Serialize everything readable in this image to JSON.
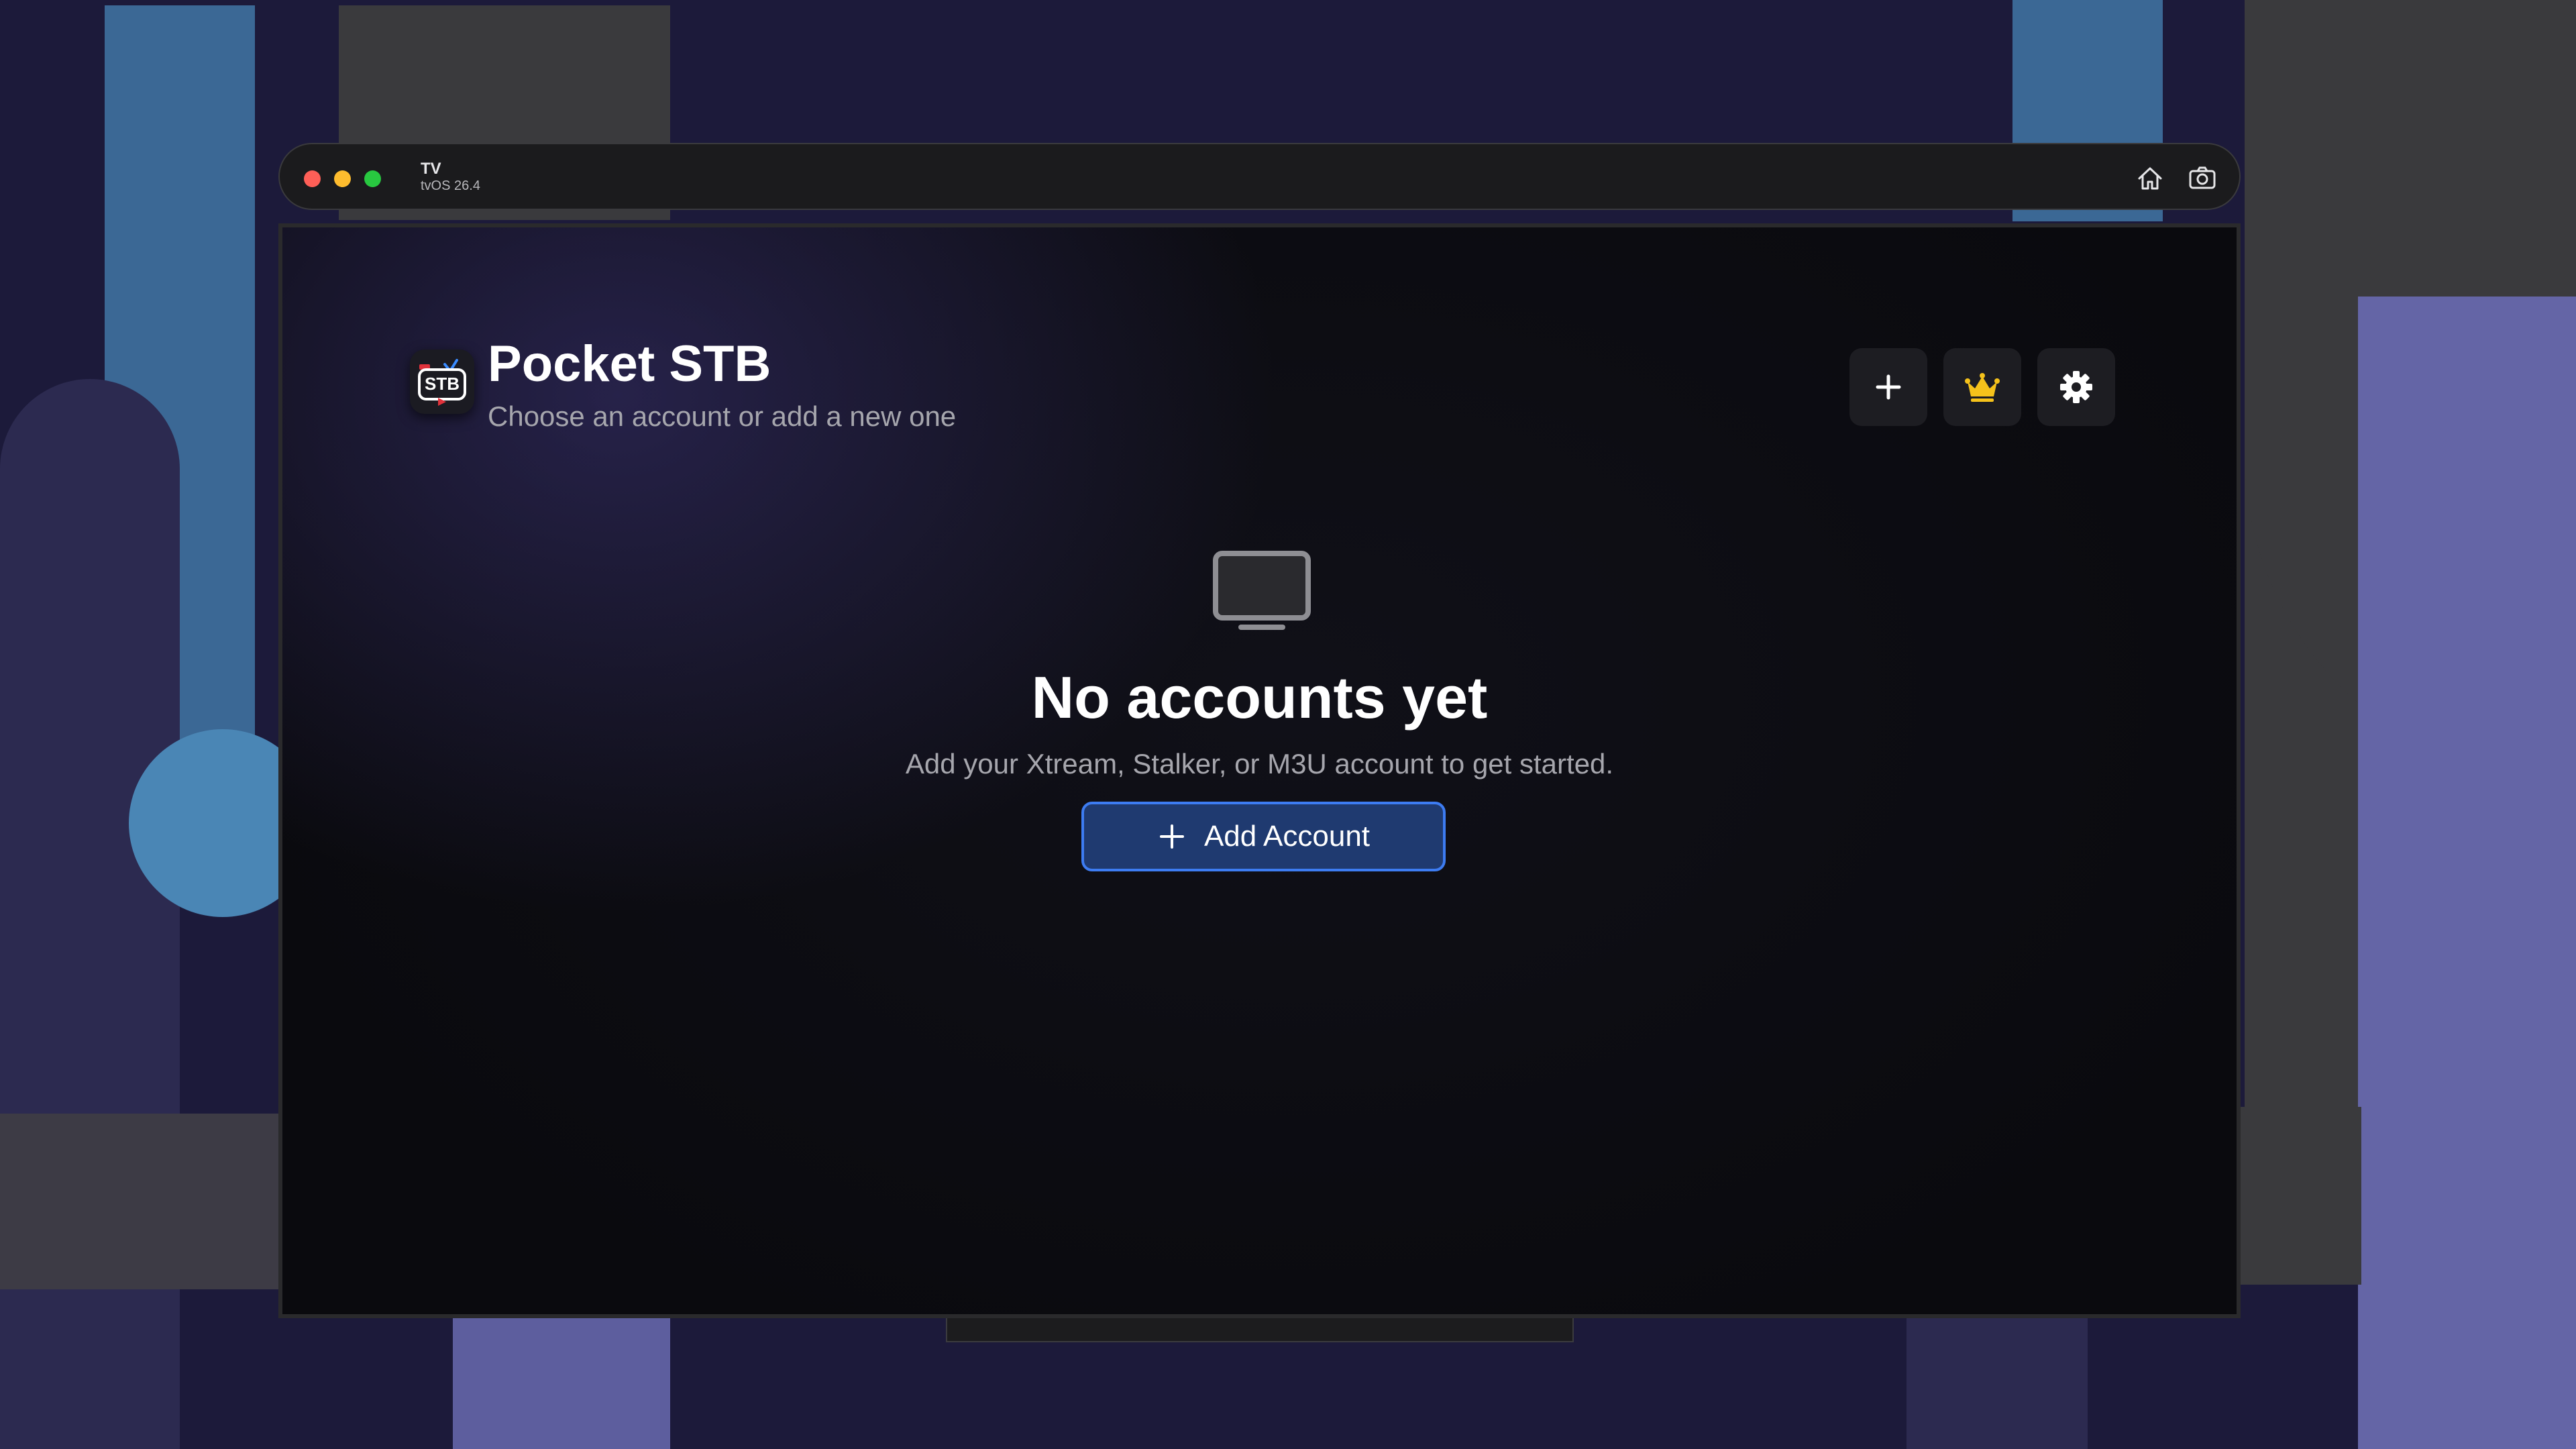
{
  "window": {
    "title": "TV",
    "subtitle": "tvOS 26.4",
    "icons": {
      "home": "home-icon",
      "screenshot": "camera-icon"
    }
  },
  "app": {
    "logo_text": "STB",
    "title": "Pocket STB",
    "subtitle": "Choose an account or add a new one",
    "header_buttons": [
      {
        "name": "add-button",
        "icon": "plus-icon"
      },
      {
        "name": "premium-button",
        "icon": "crown-icon"
      },
      {
        "name": "settings-button",
        "icon": "gear-icon"
      }
    ]
  },
  "empty_state": {
    "icon": "tv-icon",
    "title": "No accounts yet",
    "description": "Add your Xtream, Stalker, or M3U account to get started.",
    "button_label": "Add Account"
  },
  "colors": {
    "accent": "#3d7cf2",
    "crown": "#f5c21b",
    "close": "#fe5f57",
    "minimize": "#febc2e",
    "zoom": "#28c840"
  }
}
